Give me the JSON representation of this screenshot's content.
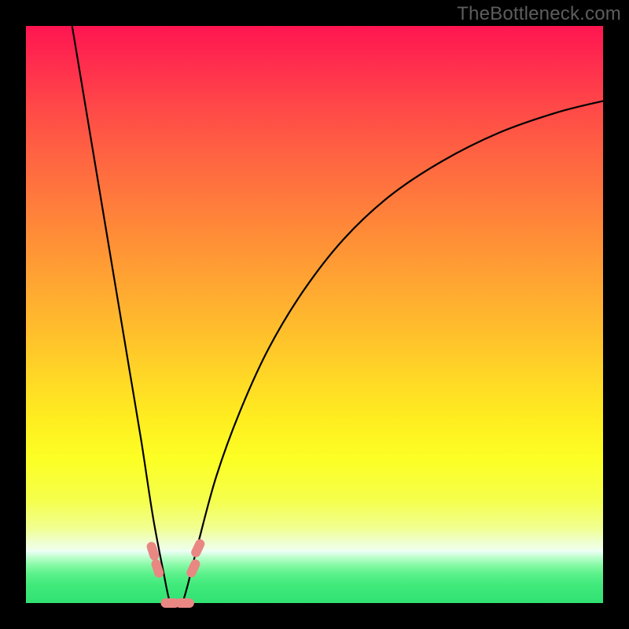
{
  "watermark": "TheBottleneck.com",
  "chart_data": {
    "type": "line",
    "title": "",
    "xlabel": "",
    "ylabel": "",
    "xlim": [
      0,
      100
    ],
    "ylim": [
      0,
      100
    ],
    "series": [
      {
        "name": "bottleneck-curve",
        "x": [
          8,
          10,
          12,
          14,
          16,
          18,
          20,
          22,
          23.8,
          25,
          26,
          27,
          28,
          30,
          33,
          37,
          42,
          48,
          55,
          63,
          72,
          82,
          92,
          100
        ],
        "values": [
          100,
          88,
          76,
          64,
          52,
          40,
          28,
          15,
          5.5,
          0,
          0,
          0,
          3,
          11,
          22,
          33,
          44,
          54,
          63,
          70.5,
          76.5,
          81.5,
          85,
          87
        ]
      }
    ],
    "markers": [
      {
        "name": "left-upper",
        "x": 22.0,
        "y": 9.0,
        "angle": 72
      },
      {
        "name": "left-lower",
        "x": 22.8,
        "y": 6.0,
        "angle": 72
      },
      {
        "name": "flat-left",
        "x": 25.0,
        "y": 0.0,
        "angle": 0
      },
      {
        "name": "flat-right",
        "x": 27.5,
        "y": 0.0,
        "angle": 0
      },
      {
        "name": "right-lower",
        "x": 29.0,
        "y": 6.0,
        "angle": -65
      },
      {
        "name": "right-upper",
        "x": 29.8,
        "y": 9.5,
        "angle": -65
      }
    ],
    "gradient_bands": [
      {
        "y": 100,
        "color": "#ff1551"
      },
      {
        "y": 50,
        "color": "#ffc22b"
      },
      {
        "y": 25,
        "color": "#fcff24"
      },
      {
        "y": 9,
        "color": "#efffe4"
      },
      {
        "y": 0,
        "color": "#30e273"
      }
    ]
  }
}
